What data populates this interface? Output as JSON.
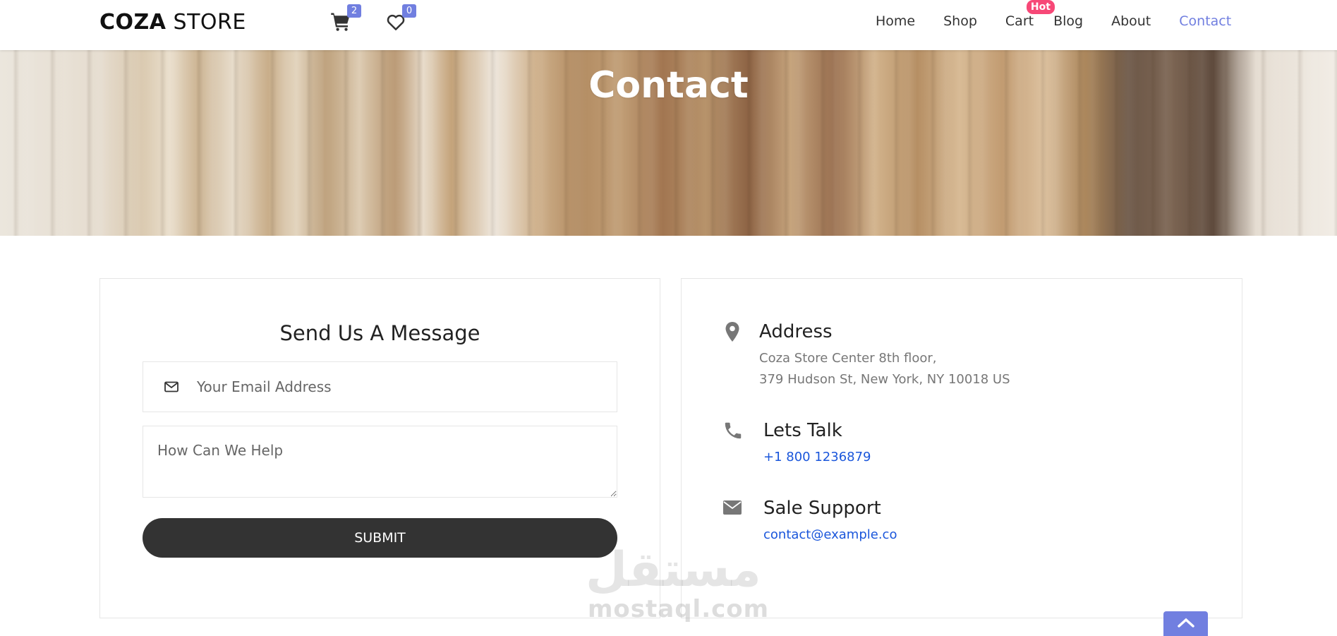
{
  "header": {
    "logo_bold": "COZA",
    "logo_light": " STORE",
    "cart_count": "2",
    "wishlist_count": "0",
    "nav": [
      {
        "label": "Home"
      },
      {
        "label": "Shop"
      },
      {
        "label": "Cart",
        "badge": "Hot"
      },
      {
        "label": "Blog"
      },
      {
        "label": "About"
      },
      {
        "label": "Contact",
        "active": true
      }
    ]
  },
  "hero": {
    "title": "Contact"
  },
  "form": {
    "title": "Send Us A Message",
    "email_placeholder": "Your Email Address",
    "message_placeholder": "How Can We Help",
    "submit_label": "SUBMIT"
  },
  "info": {
    "address": {
      "title": "Address",
      "line1": "Coza Store Center 8th floor,",
      "line2": "379 Hudson St, New York, NY 10018 US"
    },
    "talk": {
      "title": "Lets Talk",
      "phone": "+1 800 1236879"
    },
    "support": {
      "title": "Sale Support",
      "email": "contact@example.co"
    }
  },
  "watermark": {
    "arabic": "مستقل",
    "latin": "mostaql.com"
  },
  "colors": {
    "accent": "#717fe0",
    "button_dark": "#333333",
    "link": "#1a56db",
    "hot_badge": "#f74877"
  },
  "icons": [
    "cart-icon",
    "heart-icon",
    "envelope-icon",
    "map-pin-icon",
    "phone-icon",
    "chevron-up-icon"
  ]
}
